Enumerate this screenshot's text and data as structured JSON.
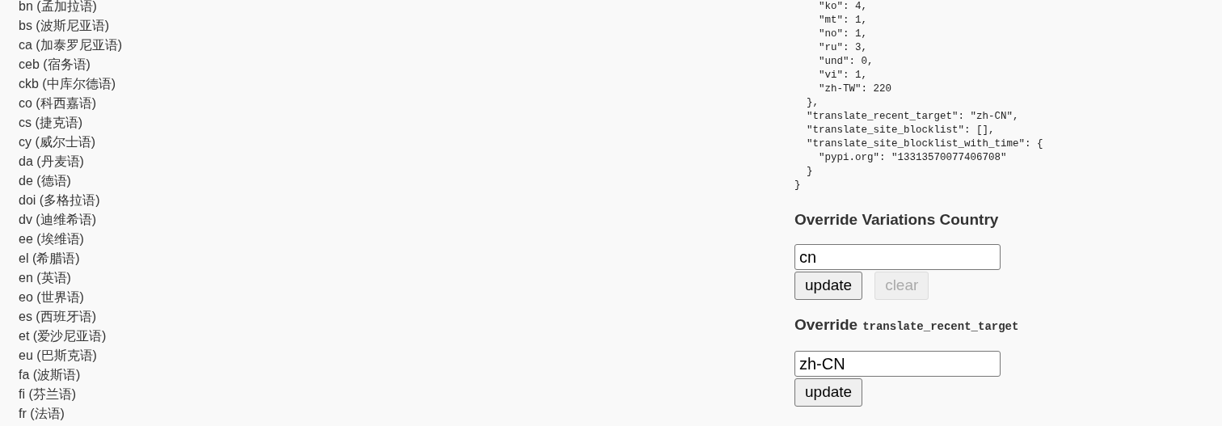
{
  "languages": [
    "bn (孟加拉语)",
    "bs (波斯尼亚语)",
    "ca (加泰罗尼亚语)",
    "ceb (宿务语)",
    "ckb (中库尔德语)",
    "co (科西嘉语)",
    "cs (捷克语)",
    "cy (威尔士语)",
    "da (丹麦语)",
    "de (德语)",
    "doi (多格拉语)",
    "dv (迪维希语)",
    "ee (埃维语)",
    "el (希腊语)",
    "en (英语)",
    "eo (世界语)",
    "es (西班牙语)",
    "et (爱沙尼亚语)",
    "eu (巴斯克语)",
    "fa (波斯语)",
    "fi (芬兰语)",
    "fr (法语)"
  ],
  "prefs_code": [
    "    \"ko\": 4,",
    "    \"mt\": 1,",
    "    \"no\": 1,",
    "    \"ru\": 3,",
    "    \"und\": 0,",
    "    \"vi\": 1,",
    "    \"zh-TW\": 220",
    "  },",
    "  \"translate_recent_target\": \"zh-CN\",",
    "  \"translate_site_blocklist\": [],",
    "  \"translate_site_blocklist_with_time\": {",
    "    \"pypi.org\": \"13313570077406708\"",
    "  }",
    "}"
  ],
  "overrides": [
    {
      "heading": "Override Variations Country",
      "value": "cn",
      "buttons": [
        {
          "label": "update",
          "disabled": false
        },
        {
          "label": "clear",
          "disabled": true
        }
      ]
    },
    {
      "heading": "Override",
      "heading_code": "translate_recent_target",
      "value": "zh-CN",
      "buttons": [
        {
          "label": "update",
          "disabled": false
        }
      ]
    }
  ]
}
